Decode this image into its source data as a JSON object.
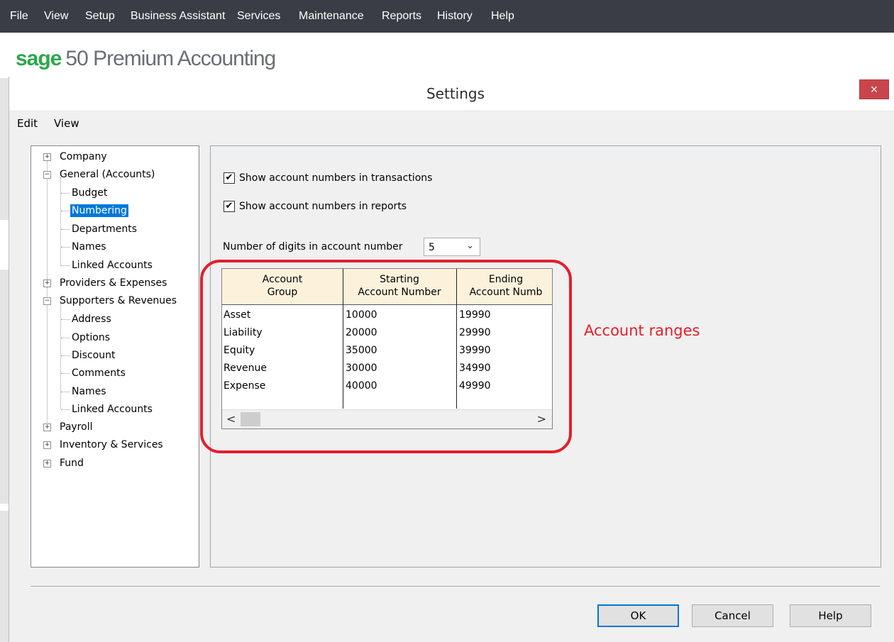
{
  "app_menu": [
    "File",
    "View",
    "Setup",
    "Business Assistant",
    "Services",
    "Maintenance",
    "Reports",
    "History",
    "Help"
  ],
  "brand": {
    "logo": "sage",
    "product": "50 Premium Accounting"
  },
  "dialog": {
    "title": "Settings",
    "close": "×",
    "menu": [
      "Edit",
      "View"
    ]
  },
  "tree": {
    "company": "Company",
    "general": "General (Accounts)",
    "budget": "Budget",
    "numbering": "Numbering",
    "departments": "Departments",
    "names1": "Names",
    "linked1": "Linked Accounts",
    "providers": "Providers & Expenses",
    "supporters": "Supporters & Revenues",
    "address": "Address",
    "options": "Options",
    "discount": "Discount",
    "comments": "Comments",
    "names2": "Names",
    "linked2": "Linked Accounts",
    "payroll": "Payroll",
    "inventory": "Inventory & Services",
    "fund": "Fund",
    "plus": "+",
    "minus": "−"
  },
  "settings": {
    "show_in_transactions": "Show account numbers in transactions",
    "show_in_reports": "Show account numbers in reports",
    "check": "✔",
    "digits_label": "Number of digits in account number",
    "digits_value": "5",
    "dropdown_arrow": "⌄"
  },
  "grid": {
    "headers": [
      {
        "l1": "Account",
        "l2": "Group"
      },
      {
        "l1": "Starting",
        "l2": "Account Number"
      },
      {
        "l1": "Ending",
        "l2": "Account Numb"
      }
    ],
    "rows": [
      {
        "group": "Asset",
        "start": "10000",
        "end": "19990"
      },
      {
        "group": "Liability",
        "start": "20000",
        "end": "29990"
      },
      {
        "group": "Equity",
        "start": "35000",
        "end": "39990"
      },
      {
        "group": "Revenue",
        "start": "30000",
        "end": "34990"
      },
      {
        "group": "Expense",
        "start": "40000",
        "end": "49990"
      }
    ],
    "scroll_left": "<",
    "scroll_right": ">"
  },
  "annotation": "Account ranges",
  "buttons": {
    "ok": "OK",
    "cancel": "Cancel",
    "help": "Help"
  },
  "colors": {
    "accent": "#0078d7",
    "annotation": "#e41e2c",
    "header_bg": "#fcf2dc",
    "brand_green": "#2ba84a"
  }
}
